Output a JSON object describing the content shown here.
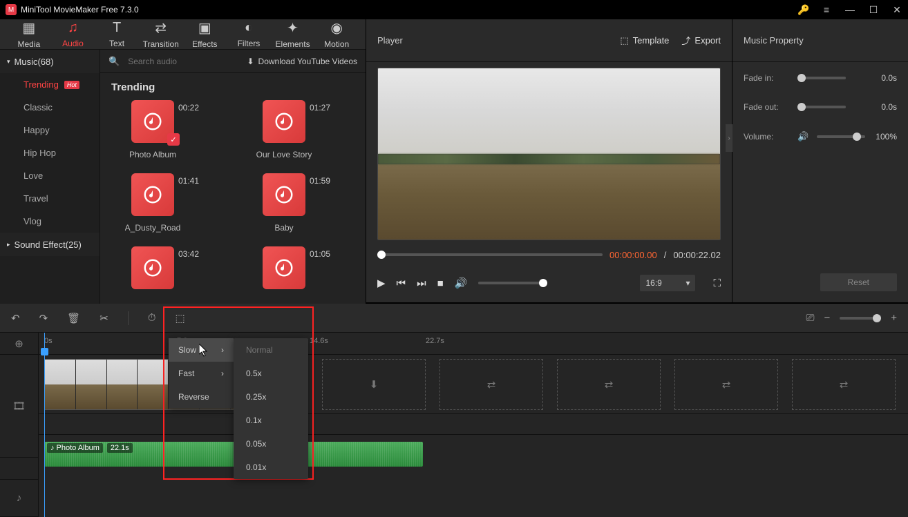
{
  "app": {
    "title": "MiniTool MovieMaker Free 7.3.0"
  },
  "topTabs": {
    "media": "Media",
    "audio": "Audio",
    "text": "Text",
    "transition": "Transition",
    "effects": "Effects",
    "filters": "Filters",
    "elements": "Elements",
    "motion": "Motion",
    "active": "Audio"
  },
  "sidebar": {
    "music_header": "Music(68)",
    "categories": [
      "Trending",
      "Classic",
      "Happy",
      "Hip Hop",
      "Love",
      "Travel",
      "Vlog"
    ],
    "hot_index": 0,
    "sound_header": "Sound Effect(25)"
  },
  "search": {
    "placeholder": "Search audio",
    "download_label": "Download YouTube Videos"
  },
  "gallery": {
    "title": "Trending",
    "items": [
      {
        "name": "Photo Album",
        "dur": "00:22",
        "checked": true
      },
      {
        "name": "Our Love Story",
        "dur": "01:27",
        "checked": false
      },
      {
        "name": "A_Dusty_Road",
        "dur": "01:41",
        "checked": false
      },
      {
        "name": "Baby",
        "dur": "01:59",
        "checked": false
      },
      {
        "name": "",
        "dur": "03:42",
        "checked": false
      },
      {
        "name": "",
        "dur": "01:05",
        "checked": false
      }
    ]
  },
  "player": {
    "title": "Player",
    "template_label": "Template",
    "export_label": "Export",
    "current": "00:00:00.00",
    "total": "00:00:22.02",
    "sep": " / ",
    "aspect": "16:9"
  },
  "props": {
    "title": "Music Property",
    "fade_in_label": "Fade in:",
    "fade_in_val": "0.0s",
    "fade_out_label": "Fade out:",
    "fade_out_val": "0.0s",
    "volume_label": "Volume:",
    "volume_val": "100%",
    "reset": "Reset"
  },
  "timeline": {
    "marks": [
      "0s",
      "7.3s",
      "14.6s",
      "22.7s"
    ],
    "audio_clip_name": "Photo Album",
    "audio_clip_dur": "22.1s"
  },
  "speed_menu": {
    "slow": "Slow",
    "fast": "Fast",
    "reverse": "Reverse",
    "sub": [
      "Normal",
      "0.5x",
      "0.25x",
      "0.1x",
      "0.05x",
      "0.01x"
    ]
  }
}
